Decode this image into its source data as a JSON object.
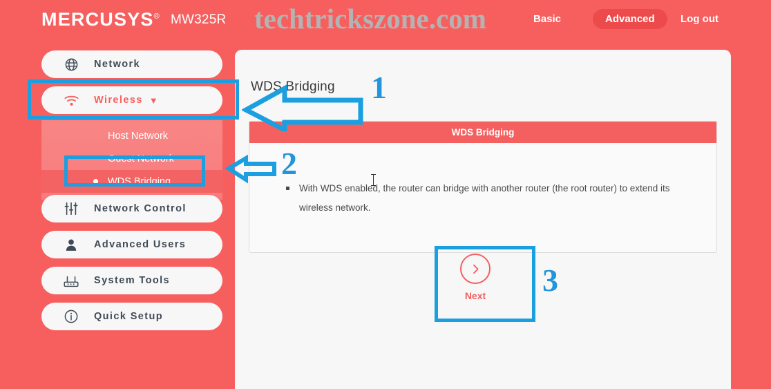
{
  "header": {
    "brand": "MERCUSYS",
    "brand_reg": "®",
    "model": "MW325R",
    "watermark": "techtrickszone.com",
    "nav": {
      "basic": "Basic",
      "advanced": "Advanced",
      "logout": "Log out"
    }
  },
  "sidebar": {
    "items": [
      {
        "label": "Network",
        "icon": "globe-icon",
        "active": false
      },
      {
        "label": "Wireless",
        "icon": "wifi-icon",
        "active": true
      },
      {
        "label": "Network Control",
        "icon": "sliders-icon",
        "active": false
      },
      {
        "label": "Advanced Users",
        "icon": "user-icon",
        "active": false
      },
      {
        "label": "System Tools",
        "icon": "router-icon",
        "active": false
      },
      {
        "label": "Quick Setup",
        "icon": "info-icon",
        "active": false
      }
    ],
    "submenu": [
      {
        "label": "Host Network",
        "selected": false
      },
      {
        "label": "Guest Network",
        "selected": false
      },
      {
        "label": "WDS Bridging",
        "selected": true
      }
    ]
  },
  "main": {
    "page_title": "WDS Bridging",
    "card_title": "WDS Bridging",
    "card_text": "With WDS enabled, the router can bridge with another router (the root router) to extend its wireless network.",
    "next_label": "Next"
  },
  "annotations": {
    "numbers": [
      "1",
      "2",
      "3"
    ]
  },
  "colors": {
    "brand_coral": "#f75f5f",
    "card_header": "#f4605f",
    "annotation_blue": "#1b9fe0",
    "panel_bg": "#f7f7f7",
    "submenu_pink": "#f88080",
    "submenu_selected": "#f46363"
  }
}
